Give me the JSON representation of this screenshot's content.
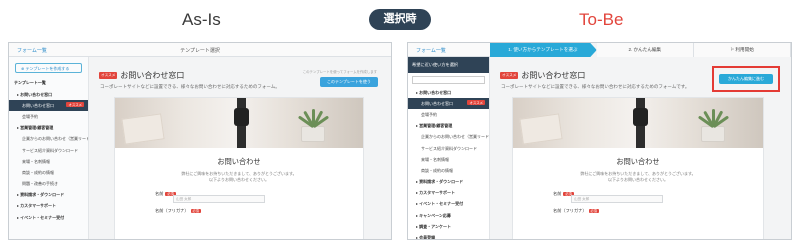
{
  "labels": {
    "asis": "As-Is",
    "center": "選択時",
    "tobe": "To-Be"
  },
  "colors": {
    "accent": "#29a9d8",
    "navy": "#2f4356",
    "red": "#e2453c"
  },
  "asis": {
    "back": "フォーム一覧",
    "window_title": "テンプレート選択",
    "create_button": "テンプレートを作成する",
    "section": "テンプレート一覧",
    "sidebar": [
      {
        "label": "お問い合わせ窓口",
        "type": "cat"
      },
      {
        "label": "お問い合わせ窓口",
        "type": "active",
        "tag": "オススメ"
      },
      {
        "label": "会場予約",
        "type": "item"
      },
      {
        "label": "営業管理/顧客管理",
        "type": "cat"
      },
      {
        "label": "企業からのお問い合わせ（営業リード管理）",
        "type": "item"
      },
      {
        "label": "サービス紹介資料ダウンロード",
        "type": "item"
      },
      {
        "label": "来場・名刺情報",
        "type": "item"
      },
      {
        "label": "商談・成約の情報",
        "type": "item"
      },
      {
        "label": "問題・改善の手続き",
        "type": "item"
      },
      {
        "label": "資料請求・ダウンロード",
        "type": "cat"
      },
      {
        "label": "カスタマーサポート",
        "type": "cat"
      },
      {
        "label": "イベント・セミナー受付",
        "type": "cat"
      }
    ],
    "main": {
      "badge": "オススメ",
      "title": "お問い合わせ窓口",
      "desc": "コーポレートサイトなどに設置できる、様々なお問い合わせに対応するためのフォーム。",
      "note": "このテンプレートを使ってフォームを作成します",
      "use_button": "このテンプレートを使う"
    }
  },
  "tobe": {
    "back": "フォーム一覧",
    "steps": [
      "1. 使い方からテンプレートを選ぶ",
      "2. かんたん編集",
      "利用開始"
    ],
    "sidebar_head": "希望に近い使い方を選択",
    "sidebar": [
      {
        "label": "お問い合わせ窓口",
        "type": "cat"
      },
      {
        "label": "お問い合わせ窓口",
        "type": "active",
        "tag": "オススメ"
      },
      {
        "label": "会場予約",
        "type": "item"
      },
      {
        "label": "営業管理/顧客管理",
        "type": "cat"
      },
      {
        "label": "企業からのお問い合わせ（営業リード管理）",
        "type": "item"
      },
      {
        "label": "サービス紹介資料ダウンロード",
        "type": "item"
      },
      {
        "label": "来場・名刺情報",
        "type": "item"
      },
      {
        "label": "商談・成約の情報",
        "type": "item"
      },
      {
        "label": "資料請求・ダウンロード",
        "type": "cat"
      },
      {
        "label": "カスタマーサポート",
        "type": "cat"
      },
      {
        "label": "イベント・セミナー受付",
        "type": "cat"
      },
      {
        "label": "キャンペーン応募",
        "type": "cat"
      },
      {
        "label": "調査・アンケート",
        "type": "cat"
      },
      {
        "label": "会員登録",
        "type": "cat"
      }
    ],
    "main": {
      "badge": "オススメ",
      "title": "お問い合わせ窓口",
      "desc": "コーポレートサイトなどに設置できる、様々なお問い合わせに対応するためのフォームです。",
      "edit_button": "かんたん編集に進む"
    }
  },
  "form": {
    "title": "お問い合わせ",
    "sub1": "弊社にご興味をお持ちいただきまして、ありがとうございます。",
    "sub2": "以下よりお問い合わせください。",
    "field1": "名前",
    "field1_placeholder": "山田 太郎",
    "field2": "名前（フリガナ）",
    "required": "必須"
  }
}
